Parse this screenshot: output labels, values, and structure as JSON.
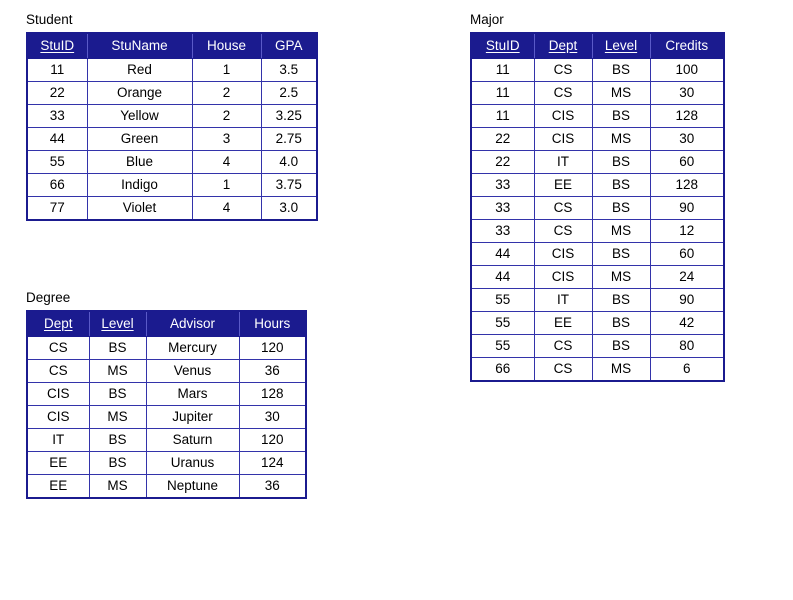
{
  "tables": [
    {
      "id": "student",
      "label": "Student",
      "columns": [
        {
          "name": "StuID",
          "key": true
        },
        {
          "name": "StuName",
          "key": false
        },
        {
          "name": "House",
          "key": false
        },
        {
          "name": "GPA",
          "key": false
        }
      ],
      "rows": [
        [
          "11",
          "Red",
          "1",
          "3.5"
        ],
        [
          "22",
          "Orange",
          "2",
          "2.5"
        ],
        [
          "33",
          "Yellow",
          "2",
          "3.25"
        ],
        [
          "44",
          "Green",
          "3",
          "2.75"
        ],
        [
          "55",
          "Blue",
          "4",
          "4.0"
        ],
        [
          "66",
          "Indigo",
          "1",
          "3.75"
        ],
        [
          "77",
          "Violet",
          "4",
          "3.0"
        ]
      ]
    },
    {
      "id": "degree",
      "label": "Degree",
      "columns": [
        {
          "name": "Dept",
          "key": true
        },
        {
          "name": "Level",
          "key": true
        },
        {
          "name": "Advisor",
          "key": false
        },
        {
          "name": "Hours",
          "key": false
        }
      ],
      "rows": [
        [
          "CS",
          "BS",
          "Mercury",
          "120"
        ],
        [
          "CS",
          "MS",
          "Venus",
          "36"
        ],
        [
          "CIS",
          "BS",
          "Mars",
          "128"
        ],
        [
          "CIS",
          "MS",
          "Jupiter",
          "30"
        ],
        [
          "IT",
          "BS",
          "Saturn",
          "120"
        ],
        [
          "EE",
          "BS",
          "Uranus",
          "124"
        ],
        [
          "EE",
          "MS",
          "Neptune",
          "36"
        ]
      ]
    },
    {
      "id": "major",
      "label": "Major",
      "columns": [
        {
          "name": "StuID",
          "key": true
        },
        {
          "name": "Dept",
          "key": true
        },
        {
          "name": "Level",
          "key": true
        },
        {
          "name": "Credits",
          "key": false
        }
      ],
      "rows": [
        [
          "11",
          "CS",
          "BS",
          "100"
        ],
        [
          "11",
          "CS",
          "MS",
          "30"
        ],
        [
          "11",
          "CIS",
          "BS",
          "128"
        ],
        [
          "22",
          "CIS",
          "MS",
          "30"
        ],
        [
          "22",
          "IT",
          "BS",
          "60"
        ],
        [
          "33",
          "EE",
          "BS",
          "128"
        ],
        [
          "33",
          "CS",
          "BS",
          "90"
        ],
        [
          "33",
          "CS",
          "MS",
          "12"
        ],
        [
          "44",
          "CIS",
          "BS",
          "60"
        ],
        [
          "44",
          "CIS",
          "MS",
          "24"
        ],
        [
          "55",
          "IT",
          "BS",
          "90"
        ],
        [
          "55",
          "EE",
          "BS",
          "42"
        ],
        [
          "55",
          "CS",
          "BS",
          "80"
        ],
        [
          "66",
          "CS",
          "MS",
          "6"
        ]
      ]
    }
  ],
  "colors": {
    "header_background": "#1b1b8f",
    "header_text": "#ffffff",
    "cell_border": "#3333aa",
    "table_outline": "#1b1b8f",
    "page_background": "#ffffff",
    "body_text": "#000000"
  }
}
